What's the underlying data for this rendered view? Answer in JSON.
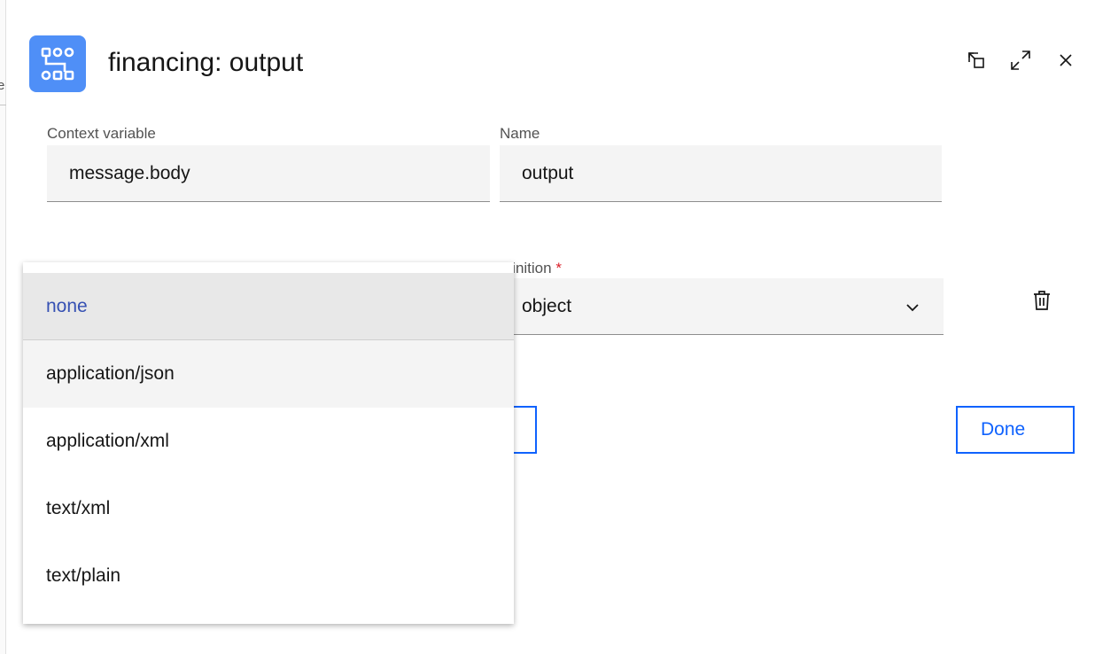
{
  "underlay": {
    "peek_text": "e"
  },
  "header": {
    "title": "financing: output",
    "app_icon": "flow-diagram-icon",
    "actions": [
      {
        "name": "undock-icon"
      },
      {
        "name": "expand-icon"
      },
      {
        "name": "close-icon"
      }
    ]
  },
  "fields": {
    "context_variable": {
      "label": "Context variable",
      "value": "message.body"
    },
    "name": {
      "label": "Name",
      "value": "output"
    },
    "definition": {
      "label": "efinition",
      "required_mark": "*",
      "value": "object"
    }
  },
  "buttons": {
    "done_label": "Done"
  },
  "content_type_menu": {
    "selected": "none",
    "options": [
      "none",
      "application/json",
      "application/xml",
      "text/xml",
      "text/plain"
    ]
  },
  "colors": {
    "accent": "#0f62fe",
    "icon_bg": "#4f8ff7",
    "selected_text": "#3651b3",
    "required": "#da1e28"
  }
}
